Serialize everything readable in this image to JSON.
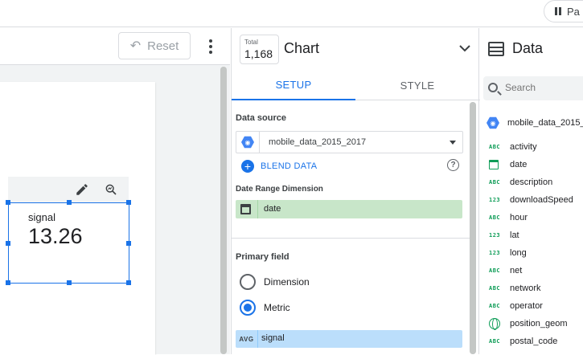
{
  "topbar": {
    "pause_label": "Pa"
  },
  "canvas": {
    "reset_label": "Reset",
    "scorecard": {
      "label": "signal",
      "value": "13.26"
    }
  },
  "props": {
    "total_label": "Total",
    "total_value": "1,168",
    "title": "Chart",
    "tabs": [
      {
        "label": "SETUP"
      },
      {
        "label": "STYLE"
      }
    ],
    "data_source_label": "Data source",
    "data_source_name": "mobile_data_2015_2017",
    "blend_label": "BLEND DATA",
    "date_range_label": "Date Range Dimension",
    "date_range_field": "date",
    "primary_field_label": "Primary field",
    "radio_dimension": "Dimension",
    "radio_metric": "Metric",
    "metric_agg": "AVG",
    "metric_field": "signal"
  },
  "data_panel": {
    "title": "Data",
    "search_placeholder": "Search",
    "source": "mobile_data_2015_",
    "fields": [
      {
        "type": "ABC",
        "name": "activity"
      },
      {
        "type": "DATE",
        "name": "date"
      },
      {
        "type": "ABC",
        "name": "description"
      },
      {
        "type": "123",
        "name": "downloadSpeed"
      },
      {
        "type": "ABC",
        "name": "hour"
      },
      {
        "type": "123",
        "name": "lat"
      },
      {
        "type": "123",
        "name": "long"
      },
      {
        "type": "ABC",
        "name": "net"
      },
      {
        "type": "ABC",
        "name": "network"
      },
      {
        "type": "ABC",
        "name": "operator"
      },
      {
        "type": "GEO",
        "name": "position_geom"
      },
      {
        "type": "ABC",
        "name": "postal_code"
      }
    ]
  },
  "colors": {
    "accent": "#1a73e8",
    "date_chip": "#c8e6c9",
    "metric_chip": "#bbdefb",
    "field_type": "#0f9d58"
  }
}
